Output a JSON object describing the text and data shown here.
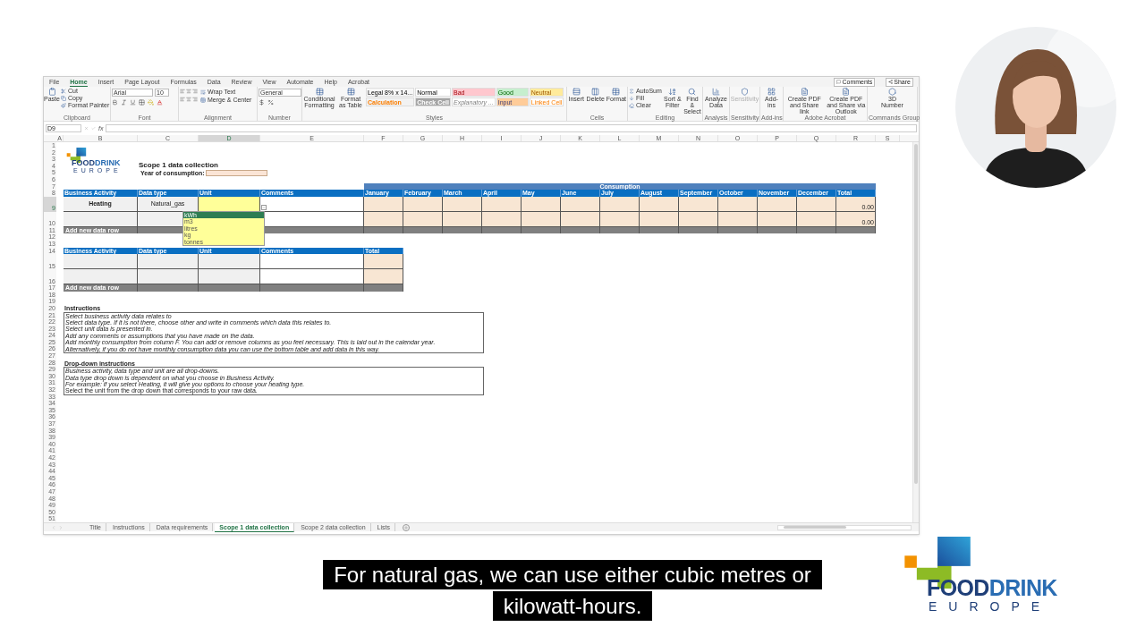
{
  "ribbon_tabs": [
    {
      "label": "File",
      "selected": false
    },
    {
      "label": "Home",
      "selected": true
    },
    {
      "label": "Insert",
      "selected": false
    },
    {
      "label": "Page Layout",
      "selected": false
    },
    {
      "label": "Formulas",
      "selected": false
    },
    {
      "label": "Data",
      "selected": false
    },
    {
      "label": "Review",
      "selected": false
    },
    {
      "label": "View",
      "selected": false
    },
    {
      "label": "Automate",
      "selected": false
    },
    {
      "label": "Help",
      "selected": false
    },
    {
      "label": "Acrobat",
      "selected": false
    }
  ],
  "ribbon_actions": [
    "Comments",
    "Share"
  ],
  "ribbon_groups": [
    {
      "kind": "clipboard",
      "label": "Clipboard",
      "disabled": false,
      "large": [
        "Paste"
      ],
      "small": [
        "Cut",
        "Copy",
        "Format Painter"
      ]
    },
    {
      "kind": "font",
      "label": "Font",
      "disabled": false,
      "font_name": "Arial",
      "font_size": "10"
    },
    {
      "kind": "alignment",
      "label": "Alignment",
      "disabled": false,
      "small": [
        "Wrap Text",
        "Merge & Center"
      ]
    },
    {
      "kind": "number",
      "label": "Number",
      "disabled": false,
      "format": "General"
    },
    {
      "kind": "styles",
      "label": "Styles",
      "disabled": false,
      "large": [
        "Conditional Formatting",
        "Format as Table"
      ],
      "cell_styles": [
        {
          "label": "Legal 8% x 14...",
          "kind": "plain",
          "color": "#f7f7f7"
        },
        {
          "label": "Normal",
          "kind": "plain",
          "color": "#ffffff"
        },
        {
          "label": "Bad",
          "kind": "bad",
          "color": "#ffc7ce"
        },
        {
          "label": "Good",
          "kind": "good",
          "color": "#c6efce"
        },
        {
          "label": "Neutral",
          "kind": "neutral",
          "color": "#ffeb9c"
        },
        {
          "label": "Calculation",
          "kind": "calculation",
          "color": "#f2f2f2"
        },
        {
          "label": "Check Cell",
          "kind": "check",
          "color": "#a5a5a5"
        },
        {
          "label": "Explanatory ...",
          "kind": "explanatory",
          "color": "#ffffff"
        },
        {
          "label": "Input",
          "kind": "input",
          "color": "#ffcc99"
        },
        {
          "label": "Linked Cell",
          "kind": "linked",
          "color": "#ffffff"
        }
      ]
    },
    {
      "kind": "buttons",
      "label": "Cells",
      "disabled": false,
      "large": [
        "Insert",
        "Delete",
        "Format"
      ]
    },
    {
      "kind": "editing",
      "label": "Editing",
      "disabled": false,
      "small": [
        "AutoSum",
        "Fill",
        "Clear"
      ],
      "large": [
        "Sort & Filter",
        "Find & Select"
      ]
    },
    {
      "kind": "buttons",
      "label": "Analysis",
      "disabled": false,
      "large": [
        "Analyze Data"
      ]
    },
    {
      "kind": "buttons",
      "label": "Sensitivity",
      "disabled": true,
      "large": [
        "Sensitivity"
      ]
    },
    {
      "kind": "buttons",
      "label": "Add-ins",
      "disabled": false,
      "large": [
        "Add-ins"
      ]
    },
    {
      "kind": "buttons",
      "label": "Adobe Acrobat",
      "disabled": false,
      "large": [
        "Create PDF and Share link",
        "Create PDF and Share via Outlook"
      ]
    },
    {
      "kind": "buttons",
      "label": "Commands Group",
      "disabled": false,
      "large": [
        "3D Number"
      ]
    }
  ],
  "formula_bar": {
    "name_box": "D9",
    "function_label": "fx"
  },
  "column_headers": [
    {
      "label": "A",
      "selected": false
    },
    {
      "label": "B",
      "selected": false
    },
    {
      "label": "C",
      "selected": false
    },
    {
      "label": "D",
      "selected": true
    },
    {
      "label": "E",
      "selected": false
    },
    {
      "label": "F",
      "selected": false
    },
    {
      "label": "G",
      "selected": false
    },
    {
      "label": "H",
      "selected": false
    },
    {
      "label": "I",
      "selected": false
    },
    {
      "label": "J",
      "selected": false
    },
    {
      "label": "K",
      "selected": false
    },
    {
      "label": "L",
      "selected": false
    },
    {
      "label": "M",
      "selected": false
    },
    {
      "label": "N",
      "selected": false
    },
    {
      "label": "O",
      "selected": false
    },
    {
      "label": "P",
      "selected": false
    },
    {
      "label": "Q",
      "selected": false
    },
    {
      "label": "R",
      "selected": false
    },
    {
      "label": "S",
      "selected": false
    }
  ],
  "row_numbers": [
    {
      "label": "1",
      "selected": false
    },
    {
      "label": "2",
      "selected": false
    },
    {
      "label": "3",
      "selected": false
    },
    {
      "label": "4",
      "selected": false
    },
    {
      "label": "5",
      "selected": false
    },
    {
      "label": "6",
      "selected": false
    },
    {
      "label": "7",
      "selected": false
    },
    {
      "label": "8",
      "selected": false
    },
    {
      "label": "9",
      "selected": true
    },
    {
      "label": "10",
      "selected": false
    },
    {
      "label": "11",
      "selected": false
    },
    {
      "label": "12",
      "selected": false
    },
    {
      "label": "13",
      "selected": false
    },
    {
      "label": "14",
      "selected": false
    },
    {
      "label": "15",
      "selected": false
    },
    {
      "label": "16",
      "selected": false
    },
    {
      "label": "17",
      "selected": false
    },
    {
      "label": "18",
      "selected": false
    },
    {
      "label": "19",
      "selected": false
    },
    {
      "label": "20",
      "selected": false
    },
    {
      "label": "21",
      "selected": false
    },
    {
      "label": "22",
      "selected": false
    },
    {
      "label": "23",
      "selected": false
    },
    {
      "label": "24",
      "selected": false
    },
    {
      "label": "25",
      "selected": false
    },
    {
      "label": "26",
      "selected": false
    },
    {
      "label": "27",
      "selected": false
    },
    {
      "label": "28",
      "selected": false
    },
    {
      "label": "29",
      "selected": false
    },
    {
      "label": "30",
      "selected": false
    },
    {
      "label": "31",
      "selected": false
    },
    {
      "label": "32",
      "selected": false
    },
    {
      "label": "33",
      "selected": false
    },
    {
      "label": "34",
      "selected": false
    },
    {
      "label": "35",
      "selected": false
    },
    {
      "label": "36",
      "selected": false
    },
    {
      "label": "37",
      "selected": false
    },
    {
      "label": "38",
      "selected": false
    },
    {
      "label": "39",
      "selected": false
    },
    {
      "label": "40",
      "selected": false
    },
    {
      "label": "41",
      "selected": false
    },
    {
      "label": "42",
      "selected": false
    },
    {
      "label": "43",
      "selected": false
    },
    {
      "label": "44",
      "selected": false
    },
    {
      "label": "45",
      "selected": false
    },
    {
      "label": "46",
      "selected": false
    },
    {
      "label": "47",
      "selected": false
    },
    {
      "label": "48",
      "selected": false
    },
    {
      "label": "49",
      "selected": false
    },
    {
      "label": "50",
      "selected": false
    },
    {
      "label": "51",
      "selected": false
    }
  ],
  "sheet": {
    "logo": {
      "part_1": "FOOD",
      "part_2": "DRINK",
      "tagline": "EUROPE"
    },
    "title": "Scope 1 data collection",
    "year_label": "Year of consumption:",
    "table_1": {
      "group_header": "Consumption",
      "columns": [
        "Business Activity",
        "Data type",
        "Unit",
        "Comments",
        "January",
        "February",
        "March",
        "April",
        "May",
        "June",
        "July",
        "August",
        "September",
        "October",
        "November",
        "December",
        "Total"
      ],
      "rows": [
        {
          "business_activity": "Heating",
          "data_type": "Natural_gas",
          "unit_active": true,
          "total": "0.00"
        },
        {
          "unit_active": false,
          "total": "0.00"
        }
      ],
      "add_row": "Add new data row",
      "unit_dropdown": [
        {
          "label": "kWh",
          "selected": true
        },
        {
          "label": "m3",
          "selected": false
        },
        {
          "label": "litres",
          "selected": false
        },
        {
          "label": "kg",
          "selected": false
        },
        {
          "label": "tonnes",
          "selected": false
        }
      ]
    },
    "table_2": {
      "columns": [
        "Business Activity",
        "Data type",
        "Unit",
        "Comments",
        "Total"
      ],
      "add_row": "Add new data row"
    },
    "instructions": {
      "title": "Instructions",
      "lines": [
        {
          "text": "Select business activity data relates to",
          "italic": true
        },
        {
          "text": "Select data type. If it is not there, choose other and write in comments which data this relates to.",
          "italic": true
        },
        {
          "text": "Select unit data is presented in.",
          "italic": true
        },
        {
          "text": "Add any comments or assumptions that you have made on the data.",
          "italic": true
        },
        {
          "text": "Add monthly consumption from column F. You can add or remove columns as you feel necessary. This is laid out in the calendar year.",
          "italic": true
        },
        {
          "text": "Alternatively, if you do not have monthly consumption data you can use the bottom table and add data in this way.",
          "italic": true
        }
      ]
    },
    "dropdown_instructions": {
      "title": "Drop-down instructions",
      "lines": [
        {
          "text": "Business activity, data type and unit are all drop-downs.",
          "italic": true
        },
        {
          "text": "Data type drop down is dependent on what you choose in Business Activity.",
          "italic": true
        },
        {
          "text": "For example: if you select Heating, it will give you options to choose your heating type.",
          "italic": true
        },
        {
          "text": "Select the unit from the drop down that corresponds to your raw data.",
          "italic": false
        }
      ]
    }
  },
  "sheet_tabs": [
    {
      "label": "Title",
      "selected": false
    },
    {
      "label": "Instructions",
      "selected": false
    },
    {
      "label": "Data requirements",
      "selected": false
    },
    {
      "label": "Scope 1 data collection",
      "selected": true
    },
    {
      "label": "Scope 2 data collection",
      "selected": false
    },
    {
      "label": "Lists",
      "selected": false
    }
  ],
  "subtitle": [
    "For natural gas, we can use either cubic metres or",
    "kilowatt-hours."
  ],
  "brand_logo": {
    "part_1": "FOOD",
    "part_2": "DRINK",
    "tagline": "EUROPE"
  }
}
